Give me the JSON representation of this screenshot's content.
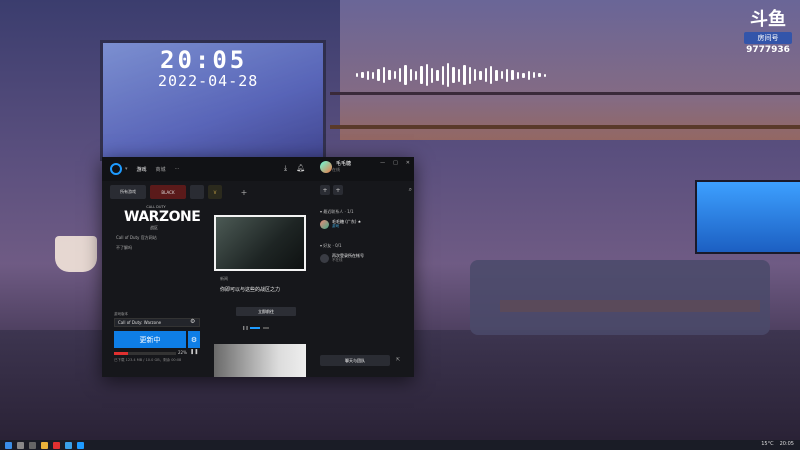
{
  "overlay": {
    "clock_time": "20:05",
    "clock_date": "2022-04-28",
    "logo_main": "斗鱼",
    "logo_sub": "房间号",
    "room_number": "9777936"
  },
  "app": {
    "tabs": [
      "游戏",
      "商城",
      "···"
    ],
    "profile_name": "毛毛糖",
    "profile_status": "在线",
    "window_controls": [
      "—",
      "□",
      "✕"
    ],
    "game_tabs": [
      "所有游戏",
      "BLACK",
      "",
      "V",
      "+"
    ],
    "game": {
      "cod_small": "CALL DUTY",
      "title": "WARZONE",
      "title_cn": "战区",
      "line1": "Call of Duty 官方网站",
      "line2": "不了解吗"
    },
    "version_label": "游戏版本",
    "version_value": "Call of Duty: Warzone",
    "update_button": "更新中",
    "progress_pct": "22%",
    "progress_value": 0.22,
    "download_info": "已下载 123.4 MB / 10.0 GB，剩余 00:08",
    "news": {
      "tag": "新闻",
      "title": "你即可以与这些的战区之力",
      "button": "立即前往"
    },
    "side": {
      "section1": "▾ 最近联系人 · 1/1",
      "friend_name": "毛毛糖 (广东) ★",
      "friend_status": "游戏",
      "section2": "▾ 好友 · 0/1",
      "friend2_name": "再次登录所在帐号",
      "friend2_status": "不在线",
      "chat_button": "聊天与团队"
    }
  },
  "taskbar": {
    "weather": "15°C",
    "time": "20:05"
  },
  "colors": {
    "accent": "#0e7ee6",
    "progress": "#e03030"
  }
}
